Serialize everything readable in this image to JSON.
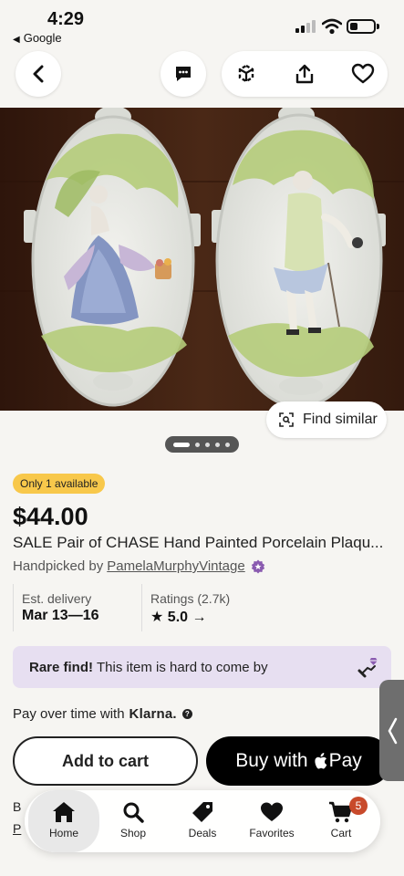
{
  "status_bar": {
    "time": "4:29",
    "back_app": "Google"
  },
  "top_nav": {
    "back_icon": "chevron-left-icon",
    "message_icon": "message-icon",
    "ar_icon": "3d-cube-icon",
    "share_icon": "share-icon",
    "favorite_icon": "heart-icon"
  },
  "photo": {
    "find_similar_label": "Find similar",
    "carousel_total": 5,
    "carousel_current": 1
  },
  "listing": {
    "availability_badge": "Only 1 available",
    "price": "$44.00",
    "title": "SALE Pair of CHASE Hand Painted Porcelain Plaqu...",
    "handpicked_prefix": "Handpicked by",
    "shop_name": "PamelaMurphyVintage"
  },
  "info": {
    "delivery_label": "Est. delivery",
    "delivery_value": "Mar 13—16",
    "ratings_label": "Ratings (2.7k)",
    "ratings_value": "5.0 →"
  },
  "rare": {
    "bold": "Rare find!",
    "text": "This item is hard to come by"
  },
  "klarna": {
    "text": "Pay over time with",
    "brand": "Klarna."
  },
  "buttons": {
    "add_to_cart": "Add to cart",
    "buy_with": "Buy with",
    "pay": "Pay"
  },
  "below": {
    "line1": "B",
    "line2": "P"
  },
  "tab_bar": {
    "tabs": [
      {
        "label": "Home",
        "icon": "home-icon"
      },
      {
        "label": "Shop",
        "icon": "search-icon"
      },
      {
        "label": "Deals",
        "icon": "tag-icon"
      },
      {
        "label": "Favorites",
        "icon": "heart-icon"
      },
      {
        "label": "Cart",
        "icon": "cart-icon"
      }
    ],
    "cart_count": "5"
  },
  "colors": {
    "badge": "#f8c84b",
    "rare_bg": "#e7dff1",
    "cart_badge": "#c84a2b",
    "photo_bg": "#3a1e12",
    "seal": "#8a5bb0"
  }
}
